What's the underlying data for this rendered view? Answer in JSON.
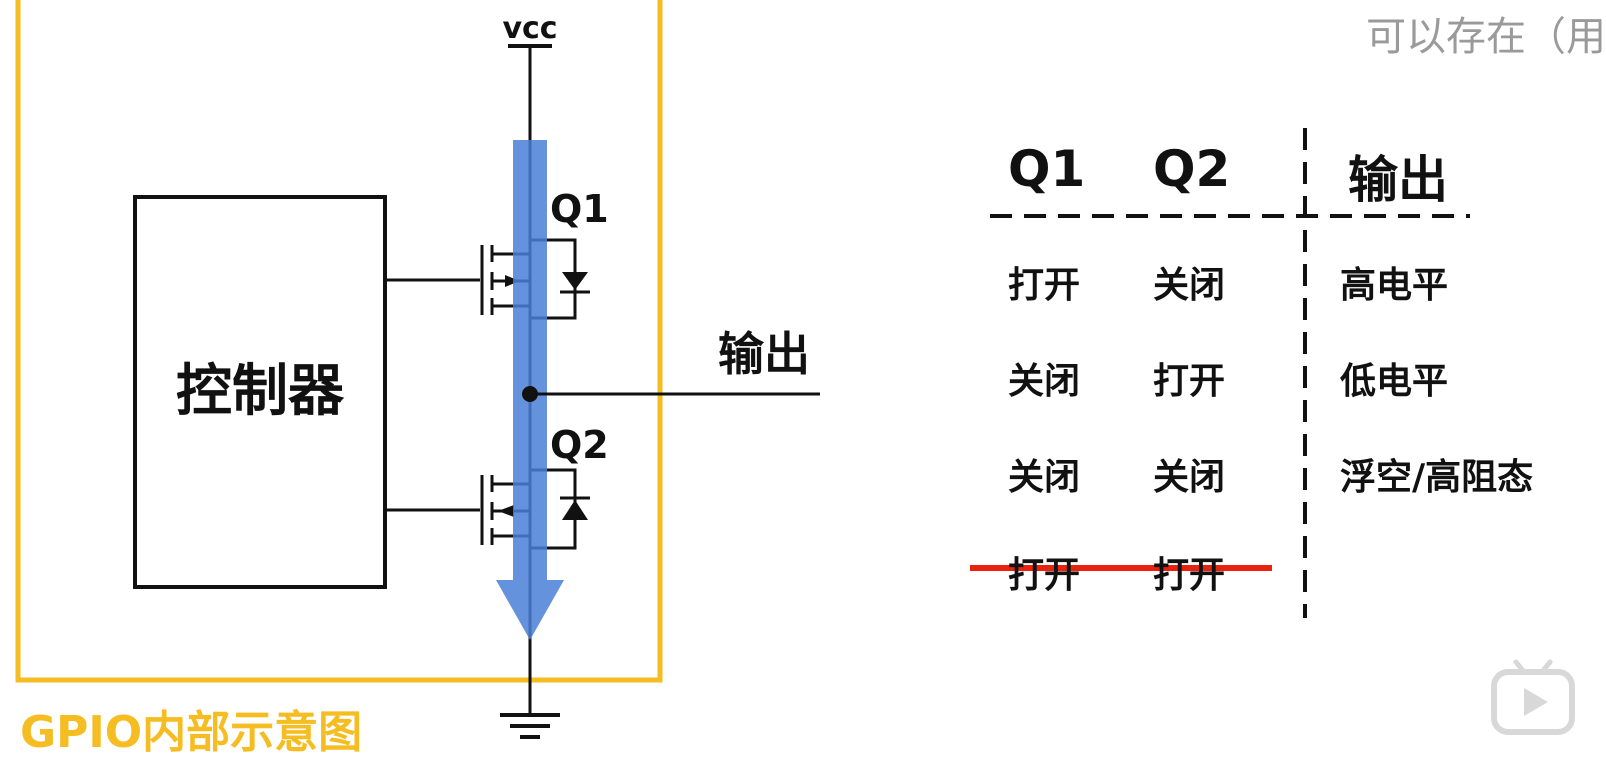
{
  "circuit": {
    "vcc_label": "vcc",
    "controller_label": "控制器",
    "q1_label": "Q1",
    "q2_label": "Q2",
    "output_label": "输出",
    "caption": "GPIO内部示意图"
  },
  "truth_table": {
    "headers": [
      "Q1",
      "Q2",
      "输出"
    ],
    "rows": [
      {
        "q1": "打开",
        "q2": "关闭",
        "output": "高电平"
      },
      {
        "q1": "关闭",
        "q2": "打开",
        "output": "低电平"
      },
      {
        "q1": "关闭",
        "q2": "关闭",
        "output": "浮空/高阻态"
      },
      {
        "q1": "打开",
        "q2": "打开",
        "output": ""
      }
    ]
  },
  "overlay": {
    "top_right_text": "可以存在（用"
  },
  "colors": {
    "frame": "#f5bd21",
    "current_arrow": "#4a7fd6",
    "strike": "#e8220f",
    "ink": "#111111"
  },
  "icons": {
    "watermark": "bilibili-tv-icon"
  }
}
